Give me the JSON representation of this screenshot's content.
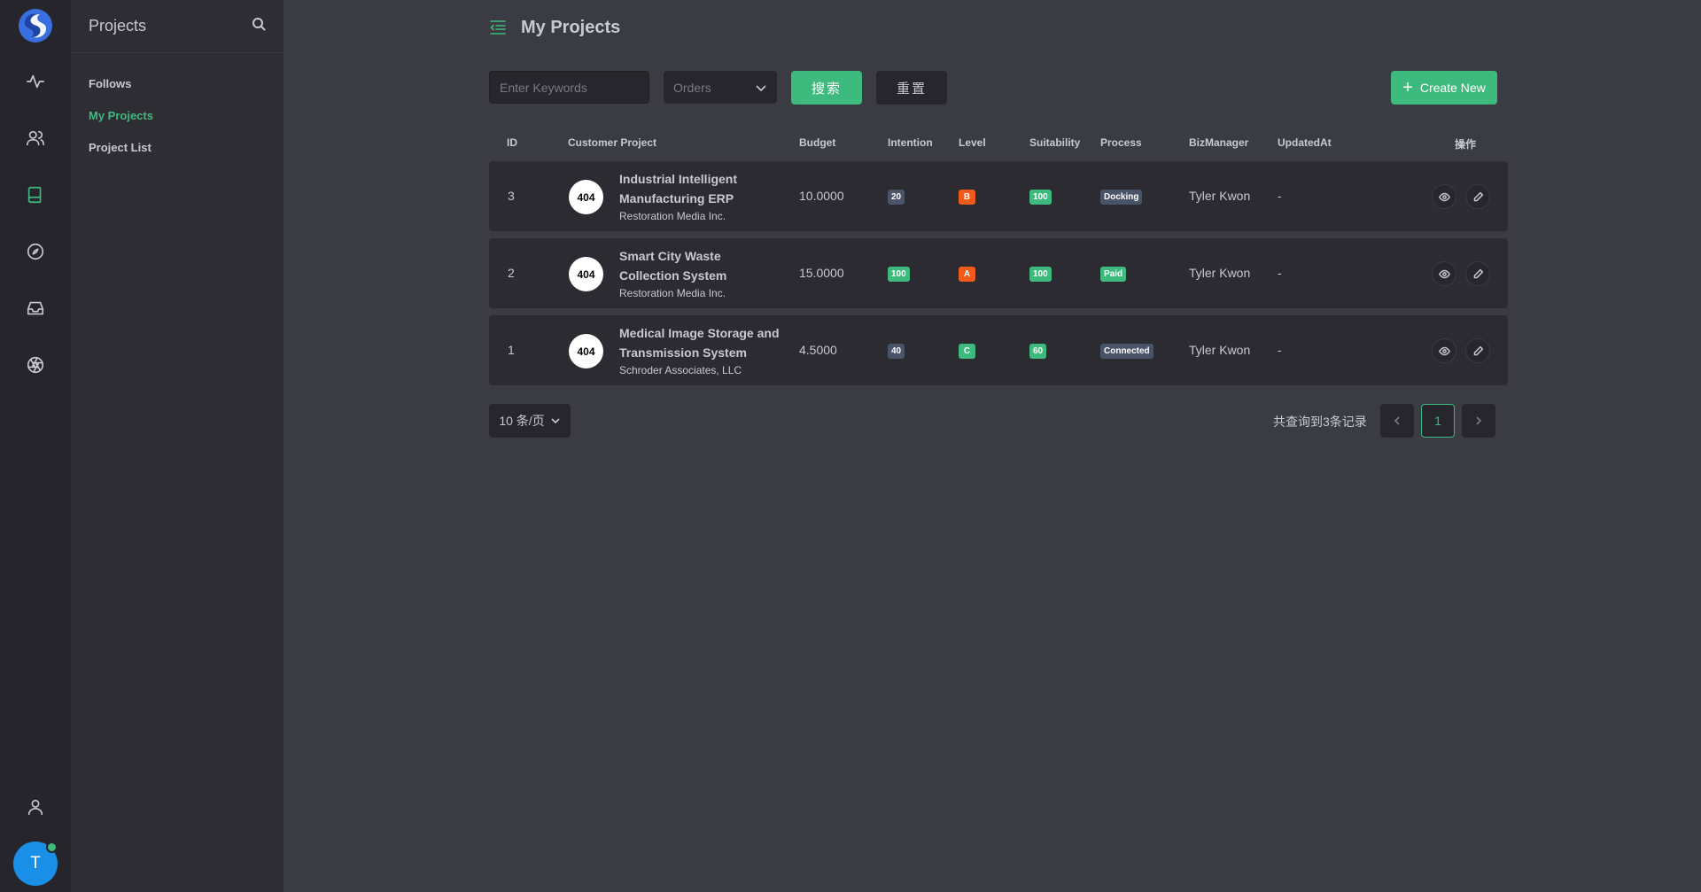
{
  "rail": {
    "icons": [
      "pulse-icon",
      "users-icon",
      "book-icon",
      "compass-icon",
      "inbox-icon",
      "aperture-icon",
      "user-icon"
    ],
    "avatar_letter": "T"
  },
  "sidebar": {
    "title": "Projects",
    "items": [
      {
        "label": "Follows",
        "active": false
      },
      {
        "label": "My Projects",
        "active": true
      },
      {
        "label": "Project List",
        "active": false
      }
    ]
  },
  "main": {
    "title": "My Projects",
    "search": {
      "placeholder": "Enter Keywords",
      "value": ""
    },
    "orders_select": {
      "placeholder": "Orders"
    },
    "search_button": "搜索",
    "reset_button": "重置",
    "create_button": "Create New"
  },
  "table": {
    "headers": {
      "id": "ID",
      "project": "Customer Project",
      "budget": "Budget",
      "intention": "Intention",
      "level": "Level",
      "suitability": "Suitability",
      "process": "Process",
      "biz": "BizManager",
      "updated": "UpdatedAt",
      "actions": "操作"
    },
    "rows": [
      {
        "id": "3",
        "logo": "404",
        "name1": "Industrial Intelligent",
        "name2": "Manufacturing ERP",
        "customer": "Restoration Media Inc.",
        "budget": "10.0000",
        "intention": "20",
        "intention_color": "#4a5468",
        "level": "B",
        "level_color": "#f05a1a",
        "suitability": "100",
        "suitability_color": "#3fba7e",
        "process": "Docking",
        "process_color": "#4a5468",
        "biz": "Tyler Kwon",
        "updated": "-"
      },
      {
        "id": "2",
        "logo": "404",
        "name1": "Smart City Waste",
        "name2": "Collection System",
        "customer": "Restoration Media Inc.",
        "budget": "15.0000",
        "intention": "100",
        "intention_color": "#3fba7e",
        "level": "A",
        "level_color": "#f05a1a",
        "suitability": "100",
        "suitability_color": "#3fba7e",
        "process": "Paid",
        "process_color": "#3fba7e",
        "biz": "Tyler Kwon",
        "updated": "-"
      },
      {
        "id": "1",
        "logo": "404",
        "name1": "Medical Image Storage and",
        "name2": "Transmission System",
        "customer": "Schroder Associates, LLC",
        "budget": "4.5000",
        "intention": "40",
        "intention_color": "#4a5468",
        "level": "C",
        "level_color": "#3fba7e",
        "suitability": "60",
        "suitability_color": "#3fba7e",
        "process": "Connected",
        "process_color": "#4a5468",
        "biz": "Tyler Kwon",
        "updated": "-"
      }
    ]
  },
  "pagination": {
    "page_size": "10 条/页",
    "total_text": "共查询到3条记录",
    "current_page": "1"
  }
}
